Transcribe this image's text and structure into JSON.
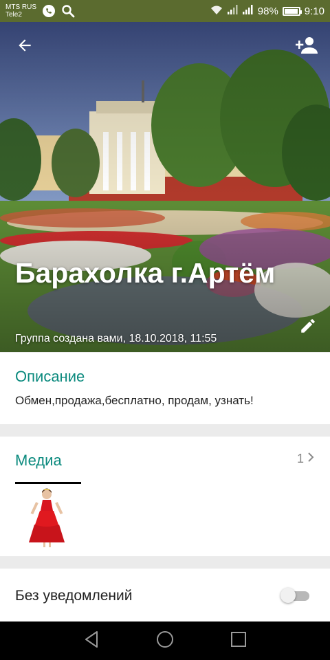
{
  "status_bar": {
    "carrier_1": "MTS RUS",
    "carrier_2": "Tele2",
    "battery": "98%",
    "battery_level": 0.98,
    "time": "9:10"
  },
  "header": {
    "title": "Барахолка г.Артём",
    "subtitle": "Группа создана вами, 18.10.2018, 11:55"
  },
  "description": {
    "label": "Описание",
    "text": "Обмен,продажа,бесплатно, продам, узнать!"
  },
  "media": {
    "label": "Медиа",
    "count": "1"
  },
  "notifications": {
    "label": "Без уведомлений",
    "enabled": false
  },
  "colors": {
    "accent": "#0b8a7e",
    "status_bar": "#5b6b2f",
    "nav_bar": "#000000"
  },
  "icons": [
    "call-icon",
    "search-icon",
    "wifi-icon",
    "signal-icon",
    "battery-icon",
    "back-arrow-icon",
    "add-participant-icon",
    "edit-pencil-icon",
    "chevron-right-icon",
    "nav-back-icon",
    "nav-home-icon",
    "nav-recents-icon"
  ]
}
